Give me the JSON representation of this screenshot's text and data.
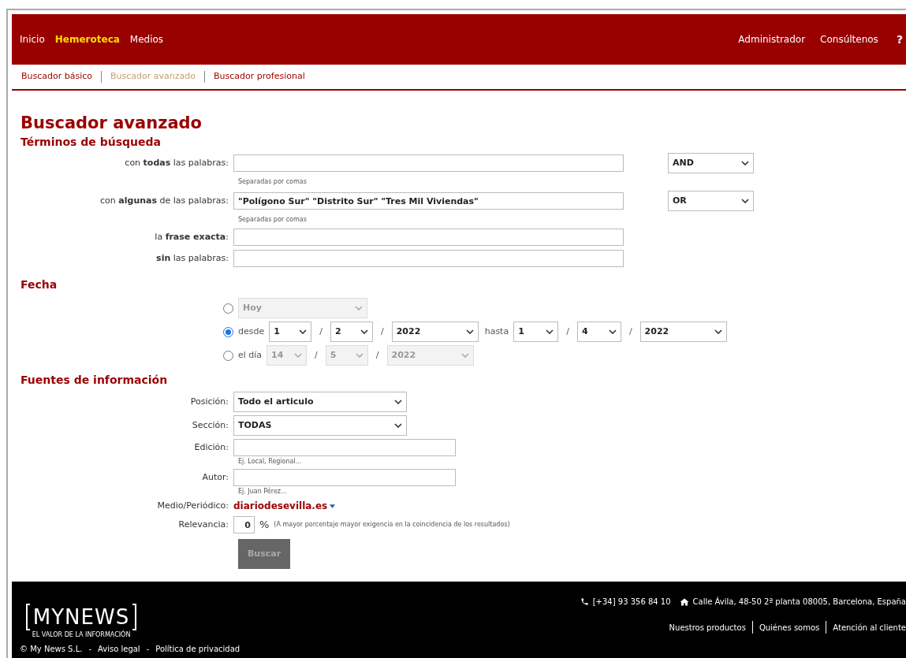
{
  "nav": {
    "left": [
      {
        "label": "Inicio",
        "selected": false
      },
      {
        "label": "Hemeroteca",
        "selected": true
      },
      {
        "label": "Medios",
        "selected": false
      }
    ],
    "right": [
      "Administrador",
      "Consúltenos"
    ],
    "help": "?"
  },
  "subnav": [
    {
      "label": "Buscador básico",
      "selected": false
    },
    {
      "label": "Buscador avanzado",
      "selected": true
    },
    {
      "label": "Buscador profesional",
      "selected": false
    }
  ],
  "title": "Buscador avanzado",
  "terms": {
    "heading": "Términos de búsqueda",
    "rows": [
      {
        "label": "con **todas** las palabras:",
        "value": "",
        "hint": "Separadas por comas",
        "operator": "AND"
      },
      {
        "label": "con **algunas** de las palabras:",
        "value": "\"Polígono Sur\" \"Distrito Sur\" \"Tres Mil Viviendas\"",
        "hint": "Separadas por comas",
        "operator": "OR"
      },
      {
        "label": "la **frase exacta**:",
        "value": ""
      },
      {
        "label": "**sin** las palabras:",
        "value": ""
      }
    ]
  },
  "fecha": {
    "heading": "Fecha",
    "options": [
      {
        "kind": "preset",
        "selected": false,
        "value": "Hoy"
      },
      {
        "kind": "range",
        "selected": true,
        "label": "desde",
        "from": [
          "1",
          "2",
          "2022"
        ],
        "to_label": "hasta",
        "to": [
          "1",
          "4",
          "2022"
        ],
        "sep": "/"
      },
      {
        "kind": "day",
        "selected": false,
        "label": "el día",
        "date": [
          "14",
          "5",
          "2022"
        ],
        "sep": "/"
      }
    ]
  },
  "fuentes": {
    "heading": "Fuentes de información",
    "fields": [
      {
        "kind": "select",
        "label": "Posición:",
        "value": "Todo el articulo"
      },
      {
        "kind": "select",
        "label": "Sección:",
        "value": "TODAS"
      },
      {
        "kind": "text",
        "label": "Edición:",
        "hint": "Ej. Local, Regional..."
      },
      {
        "kind": "text",
        "label": "Autor:",
        "hint": "Ej. Juan Pérez..."
      },
      {
        "kind": "link",
        "label": "Medio/Periódico:",
        "value": "diariodesevilla.es"
      },
      {
        "kind": "percent",
        "label": "Relevancia:",
        "value": "0",
        "unit": "%",
        "note": "(A mayor porcentaje mayor exigencia en la coincidencia de los resultados)"
      }
    ],
    "button": {
      "label": "Buscar",
      "disabled": true
    }
  },
  "footer": {
    "logo": "MYNEWS",
    "tagline": "EL VALOR DE LA INFORMACIÓN",
    "phone": "[+34] 93 356 84 10",
    "address": "Calle Ávila, 48-50 2ª planta 08005, Barcelona, España",
    "links": [
      "Nuestros productos",
      "Quiénes somos",
      "Atención al cliente"
    ],
    "legal": [
      "© My News S.L.",
      "-",
      "Aviso legal",
      "-",
      "Política de privacidad"
    ]
  }
}
